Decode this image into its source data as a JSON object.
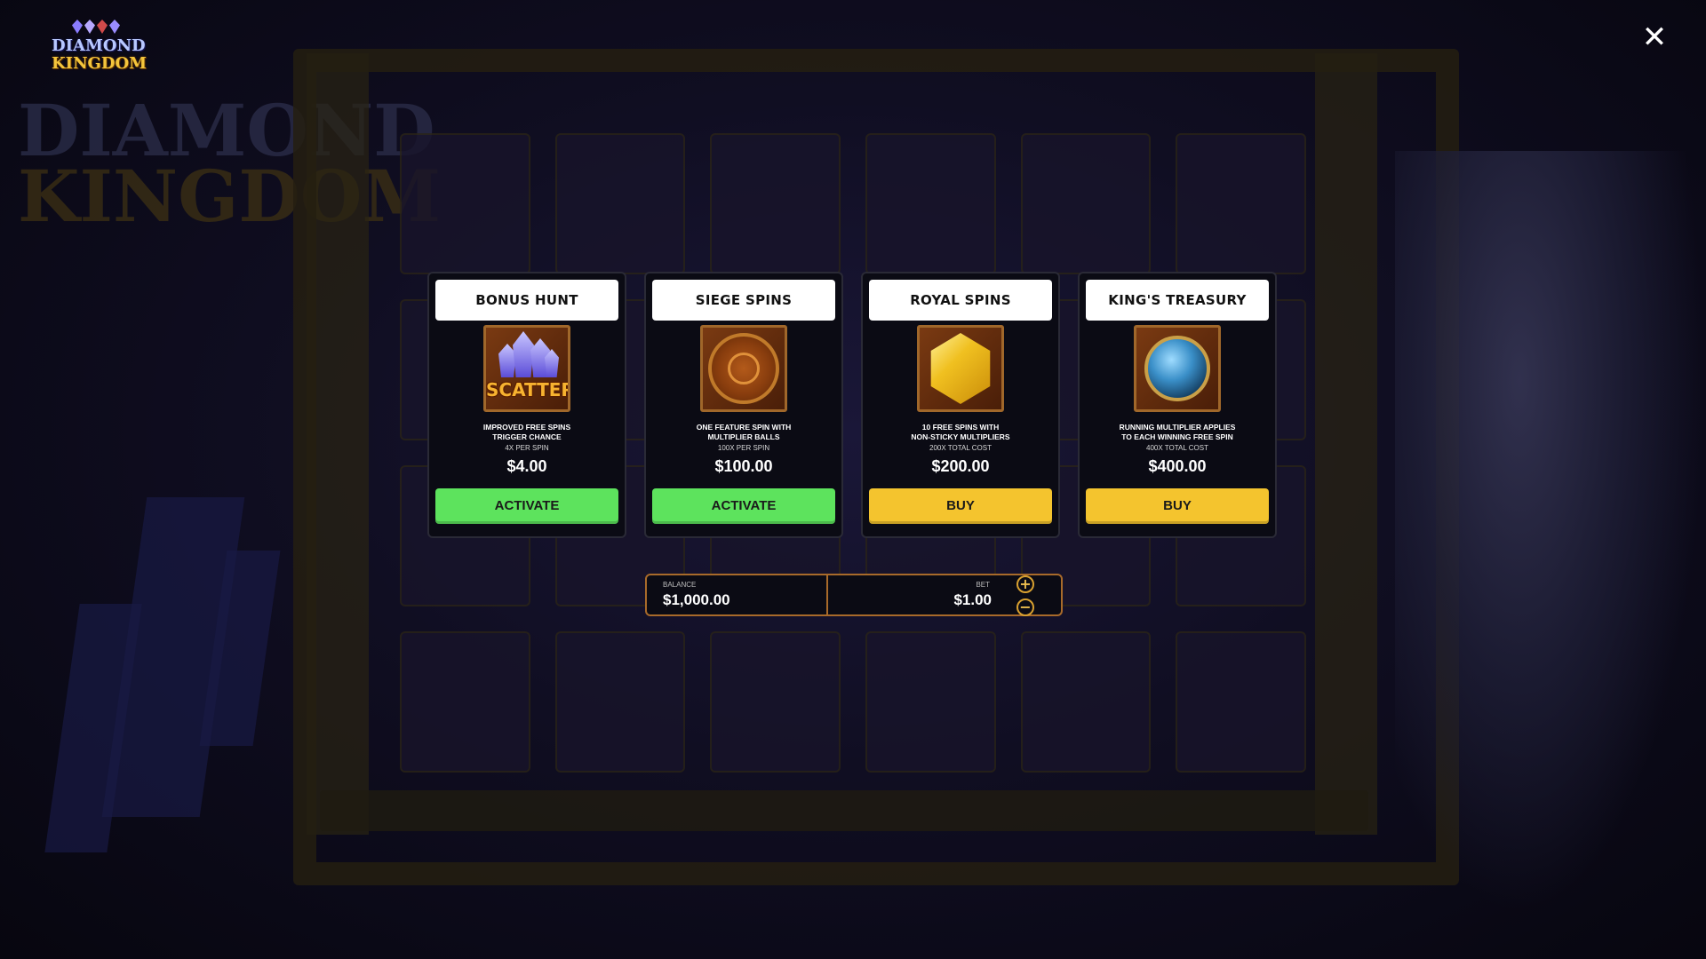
{
  "game": {
    "logo_line1": "DIAMOND",
    "logo_line2": "KINGDOM"
  },
  "close_label": "✕",
  "cards": [
    {
      "title": "BONUS HUNT",
      "icon": "scatter-icon",
      "icon_text": "SCATTER",
      "desc_line1": "IMPROVED FREE SPINS",
      "desc_line2": "TRIGGER CHANCE",
      "cost": "4X PER SPIN",
      "price": "$4.00",
      "button": "ACTIVATE",
      "button_color": "#5de35d"
    },
    {
      "title": "SIEGE SPINS",
      "icon": "medallion-icon",
      "desc_line1": "ONE FEATURE SPIN WITH",
      "desc_line2": "MULTIPLIER BALLS",
      "cost": "100X PER SPIN",
      "price": "$100.00",
      "button": "ACTIVATE",
      "button_color": "#5de35d"
    },
    {
      "title": "ROYAL SPINS",
      "icon": "gold-dice-icon",
      "desc_line1": "10 FREE SPINS WITH",
      "desc_line2": "NON-STICKY MULTIPLIERS",
      "cost": "200X TOTAL COST",
      "price": "$200.00",
      "button": "BUY",
      "button_color": "#f4c42e"
    },
    {
      "title": "KING'S TREASURY",
      "icon": "blue-orb-icon",
      "desc_line1": "RUNNING MULTIPLIER APPLIES",
      "desc_line2": "TO EACH WINNING FREE SPIN",
      "cost": "400X TOTAL COST",
      "price": "$400.00",
      "button": "BUY",
      "button_color": "#f4c42e"
    }
  ],
  "wallet": {
    "balance_label": "BALANCE",
    "balance": "$1,000.00",
    "bet_label": "BET",
    "bet": "$1.00",
    "plus": "+",
    "minus": "−"
  }
}
